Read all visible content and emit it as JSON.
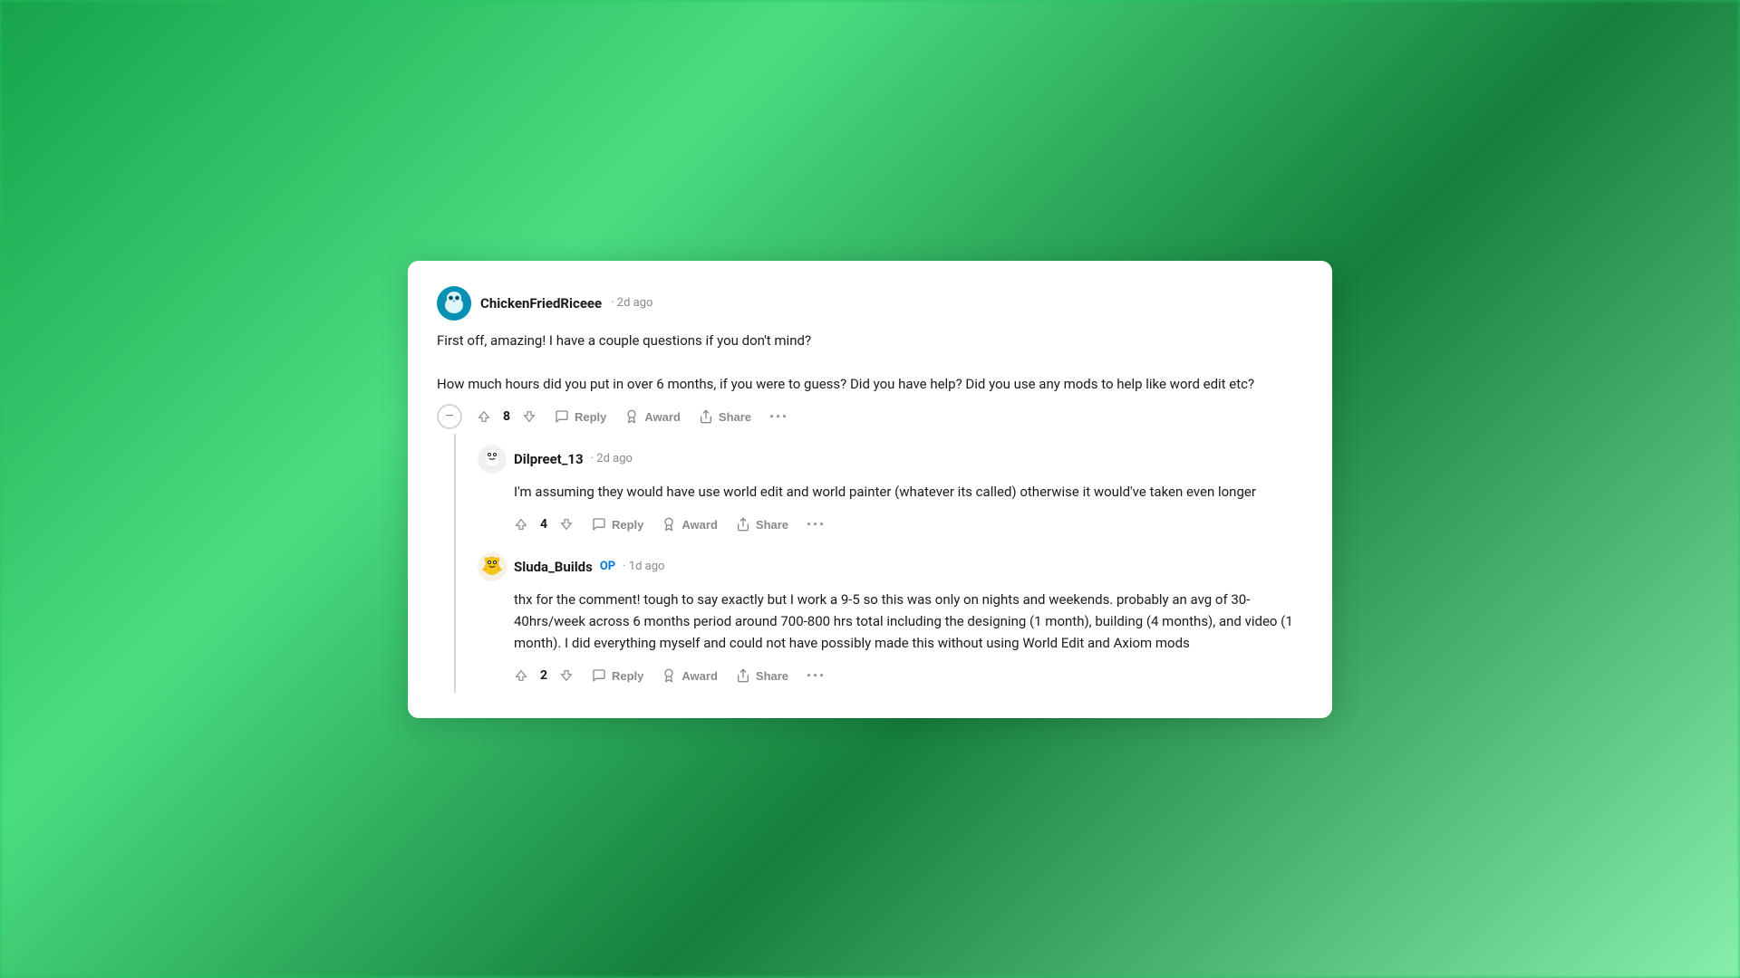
{
  "background": {
    "color1": "#16a34a",
    "color2": "#4ade80"
  },
  "comments": [
    {
      "id": "comment-1",
      "username": "ChickenFriedRiceee",
      "timestamp": "2d ago",
      "op": false,
      "avatarType": "chicken",
      "voteCount": "8",
      "body_lines": [
        "First off, amazing! I have a couple questions if you don't mind?",
        "How much hours did you put in over 6 months, if you were to guess? Did you have help? Did you use any mods to help like word edit etc?"
      ],
      "actions": {
        "reply": "Reply",
        "award": "Award",
        "share": "Share"
      },
      "replies": [
        {
          "id": "reply-1",
          "username": "Dilpreet_13",
          "timestamp": "2d ago",
          "op": false,
          "avatarType": "reddit-default",
          "voteCount": "4",
          "body": "I'm assuming they would have use world edit and world painter (whatever its called) otherwise it would've taken even longer",
          "actions": {
            "reply": "Reply",
            "award": "Award",
            "share": "Share"
          }
        },
        {
          "id": "reply-2",
          "username": "Sluda_Builds",
          "timestamp": "1d ago",
          "op": true,
          "avatarType": "reddit-yellow",
          "voteCount": "2",
          "body": "thx for the comment! tough to say exactly but I work a 9-5 so this was only on nights and weekends. probably an avg of 30-40hrs/week across 6 months period around 700-800 hrs total including the designing (1 month), building (4 months), and video (1 month). I did everything myself and could not have possibly made this without using World Edit and Axiom mods",
          "actions": {
            "reply": "Reply",
            "award": "Award",
            "share": "Share"
          }
        }
      ]
    }
  ],
  "labels": {
    "op": "OP",
    "dot": "·",
    "more": "···"
  }
}
